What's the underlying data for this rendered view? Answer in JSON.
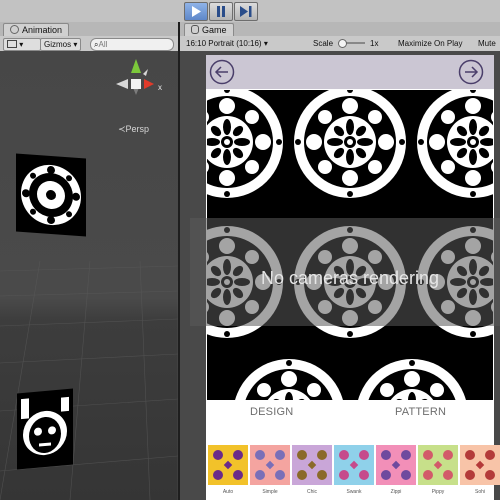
{
  "toolbar": {
    "play_icon": "play-icon",
    "pause_icon": "pause-icon",
    "step_icon": "step-icon",
    "accent": "#5e87c9"
  },
  "scene": {
    "tab_label": "Animation",
    "gizmos_label": "Gizmos",
    "search_placeholder": "All",
    "persp_label": "Persp",
    "axis_x_label": "x",
    "axis_x_color": "#e03a2a",
    "axis_y_color": "#7cc83b",
    "axis_z_color": "#4a7de8"
  },
  "game": {
    "tab_label": "Game",
    "aspect_label": "16:10 Portrait (10:16)",
    "scale_label": "Scale",
    "scale_value": "1x",
    "maximize_label": "Maximize On Play",
    "mute_label": "Mute",
    "overlay_text": "No cameras rendering",
    "design_label": "DESIGN",
    "pattern_label": "PATTERN",
    "header_bg": "#cbc6d3",
    "arrow_color": "#4a3e6a",
    "swatches": [
      {
        "label": "Auto",
        "bg": "#f2c22a",
        "fg": "#6a2a8a"
      },
      {
        "label": "Simple",
        "bg": "#f4a4a0",
        "fg": "#7a6fb8"
      },
      {
        "label": "Chic",
        "bg": "#c9a6d8",
        "fg": "#8a6a2a"
      },
      {
        "label": "Swank",
        "bg": "#8fd1ea",
        "fg": "#c64a8c"
      },
      {
        "label": "Zippi",
        "bg": "#f28fb8",
        "fg": "#6f4a9e"
      },
      {
        "label": "Pippy",
        "bg": "#c7e08a",
        "fg": "#d25a6a"
      },
      {
        "label": "Sohi",
        "bg": "#f8c4a8",
        "fg": "#b43a3a"
      }
    ]
  }
}
